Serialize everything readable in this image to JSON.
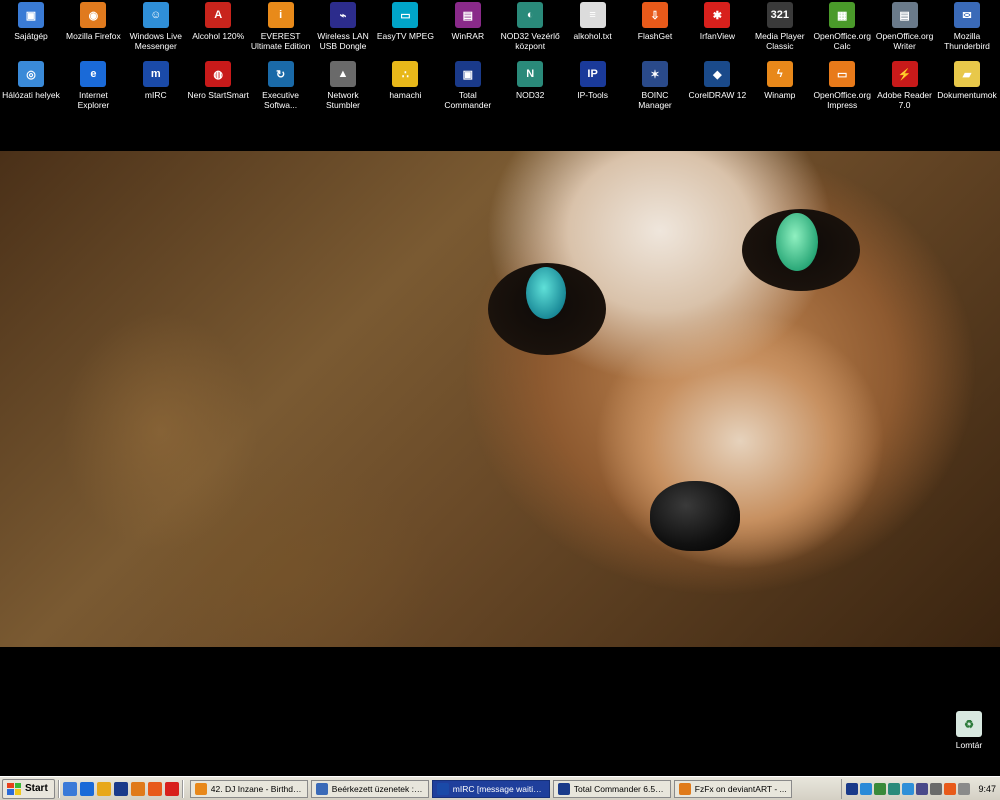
{
  "desktop_icons": [
    {
      "label": "Sajátgép",
      "icon": "my-computer-icon",
      "color": "#3a7bd5",
      "glyph": "▣"
    },
    {
      "label": "Mozilla Firefox",
      "icon": "firefox-icon",
      "color": "#e07a1e",
      "glyph": "◉"
    },
    {
      "label": "Windows Live Messenger",
      "icon": "messenger-icon",
      "color": "#2f8fd8",
      "glyph": "☺"
    },
    {
      "label": "Alcohol 120%",
      "icon": "alcohol-icon",
      "color": "#c8241c",
      "glyph": "A"
    },
    {
      "label": "EVEREST Ultimate Edition",
      "icon": "everest-icon",
      "color": "#e88a1a",
      "glyph": "i"
    },
    {
      "label": "Wireless LAN USB Dongle",
      "icon": "wireless-lan-icon",
      "color": "#2c2c8c",
      "glyph": "⌁"
    },
    {
      "label": "EasyTV MPEG",
      "icon": "easytv-icon",
      "color": "#00a4c8",
      "glyph": "▭"
    },
    {
      "label": "WinRAR",
      "icon": "winrar-icon",
      "color": "#8a2a8a",
      "glyph": "▤"
    },
    {
      "label": "NOD32 Vezérlő központ",
      "icon": "nod32-control-icon",
      "color": "#2a8a7a",
      "glyph": "◐"
    },
    {
      "label": "alkohol.txt",
      "icon": "text-file-icon",
      "color": "#dcdcdc",
      "glyph": "≡"
    },
    {
      "label": "FlashGet",
      "icon": "flashget-icon",
      "color": "#e85a1a",
      "glyph": "⇩"
    },
    {
      "label": "IrfanView",
      "icon": "irfanview-icon",
      "color": "#d8201c",
      "glyph": "✱"
    },
    {
      "label": "Media Player Classic",
      "icon": "media-player-classic-icon",
      "color": "#3a3a3a",
      "glyph": "321"
    },
    {
      "label": "OpenOffice.org Calc",
      "icon": "openoffice-calc-icon",
      "color": "#4a9a2a",
      "glyph": "▦"
    },
    {
      "label": "OpenOffice.org Writer",
      "icon": "openoffice-writer-icon",
      "color": "#6a7a8a",
      "glyph": "▤"
    },
    {
      "label": "Mozilla Thunderbird",
      "icon": "thunderbird-icon",
      "color": "#3a6ab8",
      "glyph": "✉"
    },
    {
      "label": "Hálózati helyek",
      "icon": "network-places-icon",
      "color": "#3a8ad8",
      "glyph": "◎"
    },
    {
      "label": "Internet Explorer",
      "icon": "internet-explorer-icon",
      "color": "#1a6ad8",
      "glyph": "e"
    },
    {
      "label": "mIRC",
      "icon": "mirc-icon",
      "color": "#1a4aa8",
      "glyph": "m"
    },
    {
      "label": "Nero StartSmart",
      "icon": "nero-icon",
      "color": "#c81a1a",
      "glyph": "◍"
    },
    {
      "label": "Executive Softwa...",
      "icon": "executive-software-icon",
      "color": "#1a6aa8",
      "glyph": "↻"
    },
    {
      "label": "Network Stumbler",
      "icon": "network-stumbler-icon",
      "color": "#6a6a6a",
      "glyph": "▲"
    },
    {
      "label": "hamachi",
      "icon": "hamachi-icon",
      "color": "#e8b81a",
      "glyph": "∴"
    },
    {
      "label": "Total Commander",
      "icon": "total-commander-icon",
      "color": "#1a3a8a",
      "glyph": "▣"
    },
    {
      "label": "NOD32",
      "icon": "nod32-icon",
      "color": "#2a8a7a",
      "glyph": "N"
    },
    {
      "label": "IP-Tools",
      "icon": "ip-tools-icon",
      "color": "#1a3a9a",
      "glyph": "IP"
    },
    {
      "label": "BOINC Manager",
      "icon": "boinc-icon",
      "color": "#2a4a8a",
      "glyph": "✶"
    },
    {
      "label": "CorelDRAW 12",
      "icon": "coreldraw-icon",
      "color": "#1a4a8a",
      "glyph": "◆"
    },
    {
      "label": "Winamp",
      "icon": "winamp-icon",
      "color": "#e8881a",
      "glyph": "ϟ"
    },
    {
      "label": "OpenOffice.org Impress",
      "icon": "openoffice-impress-icon",
      "color": "#e87a1a",
      "glyph": "▭"
    },
    {
      "label": "Adobe Reader 7.0",
      "icon": "adobe-reader-icon",
      "color": "#c81a1a",
      "glyph": "⚡"
    },
    {
      "label": "Dokumentumok",
      "icon": "my-documents-icon",
      "color": "#e8c84a",
      "glyph": "▰"
    }
  ],
  "recycle_bin": {
    "label": "Lomtár",
    "icon": "recycle-bin-icon"
  },
  "taskbar": {
    "start_label": "Start",
    "quick_launch": [
      {
        "icon": "show-desktop-icon",
        "color": "#3a7ad8"
      },
      {
        "icon": "internet-explorer-quick-icon",
        "color": "#1a6ad8"
      },
      {
        "icon": "media-player-quick-icon",
        "color": "#e8a81a"
      },
      {
        "icon": "total-commander-quick-icon",
        "color": "#1a3a8a"
      },
      {
        "icon": "firefox-quick-icon",
        "color": "#e07a1a"
      },
      {
        "icon": "flashget-quick-icon",
        "color": "#e85a1a"
      },
      {
        "icon": "irfanview-quick-icon",
        "color": "#d8201c"
      }
    ],
    "tasks": [
      {
        "label": "42. DJ Inzane - Birthda...",
        "icon": "winamp-task-icon",
        "color": "#e8881a",
        "active": false
      },
      {
        "label": "Beérkezett üzenetek : I...",
        "icon": "thunderbird-task-icon",
        "color": "#3a6ab8",
        "active": false
      },
      {
        "label": "mIRC [message waiting...",
        "icon": "mirc-task-icon",
        "color": "#1a4aa8",
        "active": true
      },
      {
        "label": "Total Commander 6.55 ...",
        "icon": "total-commander-task-icon",
        "color": "#1a3a8a",
        "active": false
      },
      {
        "label": "FzFx on deviantART - ...",
        "icon": "firefox-task-icon",
        "color": "#e07a1a",
        "active": false
      }
    ],
    "tray_icons": [
      {
        "icon": "tray-h-icon",
        "color": "#1a3a8a"
      },
      {
        "icon": "tray-globe-icon",
        "color": "#2a8ad8"
      },
      {
        "icon": "tray-network-icon",
        "color": "#3a8a3a"
      },
      {
        "icon": "tray-nod32-icon",
        "color": "#2a8a7a"
      },
      {
        "icon": "tray-messenger-icon",
        "color": "#2f8fd8"
      },
      {
        "icon": "tray-monitor-icon",
        "color": "#4a4a8a"
      },
      {
        "icon": "tray-boinc-icon",
        "color": "#6a6a6a"
      },
      {
        "icon": "tray-flashget-icon",
        "color": "#e85a1a"
      },
      {
        "icon": "tray-volume-icon",
        "color": "#8a8a8a"
      }
    ],
    "clock": "9:47"
  }
}
